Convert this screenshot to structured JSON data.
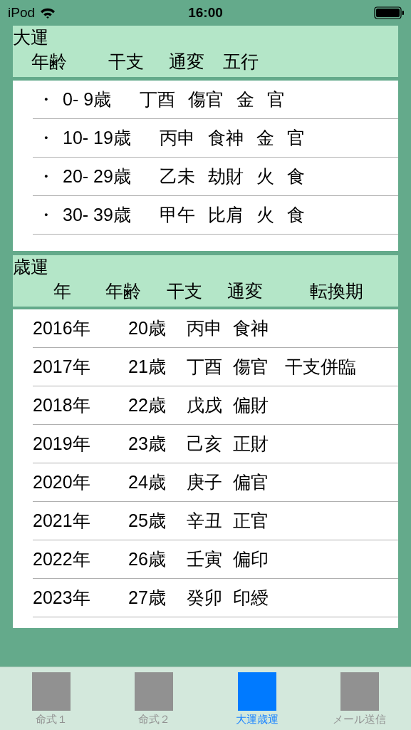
{
  "status_bar": {
    "carrier": "iPod",
    "time": "16:00"
  },
  "sections": [
    {
      "kind": "daiun",
      "title": "大運",
      "columns": [
        "年齢",
        "干支",
        "通変",
        "五行"
      ],
      "rows": [
        {
          "cells": [
            "・",
            "0- 9歳",
            "丁酉",
            "傷官",
            "金",
            "官"
          ]
        },
        {
          "cells": [
            "・",
            "10- 19歳",
            "丙申",
            "食神",
            "金",
            "官"
          ]
        },
        {
          "cells": [
            "・",
            "20- 29歳",
            "乙未",
            "劫財",
            "火",
            "食"
          ]
        },
        {
          "cells": [
            "・",
            "30- 39歳",
            "甲午",
            "比肩",
            "火",
            "食"
          ]
        }
      ]
    },
    {
      "kind": "saiun",
      "title": "歳運",
      "columns": [
        "年",
        "年齢",
        "干支",
        "通変",
        "転換期"
      ],
      "rows": [
        {
          "cells": [
            "2016年",
            "20歳",
            "丙申",
            "食神"
          ]
        },
        {
          "cells": [
            "2017年",
            "21歳",
            "丁酉",
            "傷官",
            "干支併臨"
          ]
        },
        {
          "cells": [
            "2018年",
            "22歳",
            "戊戌",
            "偏財"
          ]
        },
        {
          "cells": [
            "2019年",
            "23歳",
            "己亥",
            "正財"
          ]
        },
        {
          "cells": [
            "2020年",
            "24歳",
            "庚子",
            "偏官"
          ]
        },
        {
          "cells": [
            "2021年",
            "25歳",
            "辛丑",
            "正官"
          ]
        },
        {
          "cells": [
            "2022年",
            "26歳",
            "壬寅",
            "偏印"
          ]
        },
        {
          "cells": [
            "2023年",
            "27歳",
            "癸卯",
            "印綬"
          ]
        }
      ]
    }
  ],
  "tab_bar": {
    "tabs": [
      {
        "label": "命式１",
        "selected": false
      },
      {
        "label": "命式２",
        "selected": false
      },
      {
        "label": "大運歳運",
        "selected": true
      },
      {
        "label": "メール送信",
        "selected": false
      }
    ]
  }
}
